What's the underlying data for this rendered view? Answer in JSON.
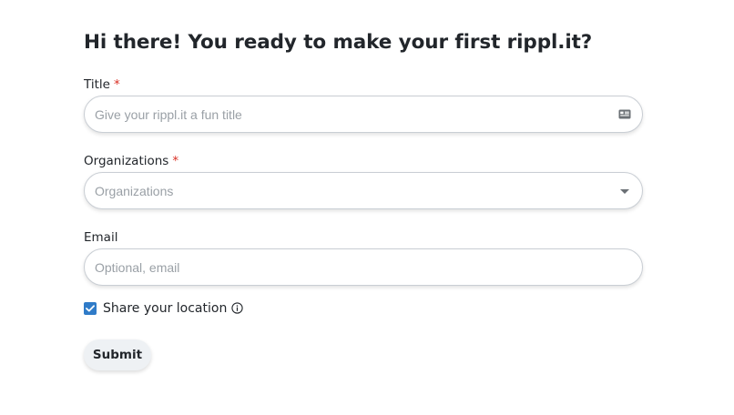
{
  "form": {
    "heading": "Hi there! You ready to make your first rippl.it?",
    "title_field": {
      "label": "Title",
      "required_marker": "*",
      "value": "",
      "placeholder": "Give your rippl.it a fun title",
      "icon": "id-card-icon"
    },
    "organizations_field": {
      "label": "Organizations",
      "required_marker": "*",
      "selected_value": "Organizations",
      "icon": "chevron-down-icon"
    },
    "email_field": {
      "label": "Email",
      "value": "",
      "placeholder": "Optional, email"
    },
    "share_location": {
      "label": "Share your location",
      "checked": true,
      "icon": "info-icon"
    },
    "submit_label": "Submit"
  },
  "colors": {
    "accent": "#2f7bc8",
    "required": "#d93025",
    "placeholder": "#9aa0a6",
    "border": "#c9ced4",
    "button_bg": "#eef1f4"
  }
}
